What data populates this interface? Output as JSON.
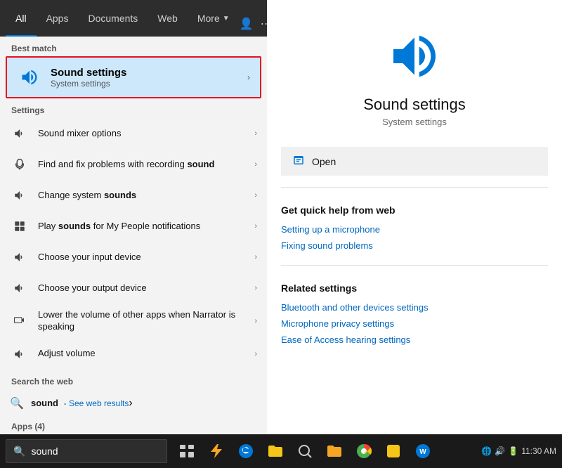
{
  "tabs": {
    "all": "All",
    "apps": "Apps",
    "documents": "Documents",
    "web": "Web",
    "more": "More",
    "more_arrow": "▼"
  },
  "best_match": {
    "label": "Best match",
    "title": "Sound settings",
    "subtitle": "System settings"
  },
  "settings_section": "Settings",
  "settings_items": [
    {
      "label": "Sound mixer options",
      "icon": "sound"
    },
    {
      "label_parts": [
        "Find and fix problems with recording ",
        "sound"
      ],
      "icon": "record"
    },
    {
      "label_parts": [
        "Change system ",
        "sounds"
      ],
      "icon": "sound"
    },
    {
      "label_parts": [
        "Play ",
        "sounds",
        " for My People notifications"
      ],
      "icon": "notification"
    },
    {
      "label_parts": [
        "Choose your input device"
      ],
      "icon": "sound"
    },
    {
      "label_parts": [
        "Choose your output device"
      ],
      "icon": "sound"
    },
    {
      "label_parts": [
        "Lower the volume of other apps when Narrator is speaking"
      ],
      "icon": "narrator"
    },
    {
      "label_parts": [
        "Adjust volume"
      ],
      "icon": "sound"
    }
  ],
  "web_search": {
    "section": "Search the web",
    "query": "sound",
    "see_web": "- See web results"
  },
  "apps_section": "Apps (4)",
  "detail": {
    "title": "Sound settings",
    "subtitle": "System settings",
    "open_label": "Open",
    "quick_help_title": "Get quick help from web",
    "quick_help_links": [
      "Setting up a microphone",
      "Fixing sound problems"
    ],
    "related_title": "Related settings",
    "related_links": [
      "Bluetooth and other devices settings",
      "Microphone privacy settings",
      "Ease of Access hearing settings"
    ]
  },
  "taskbar": {
    "search_placeholder": "sound",
    "search_value": "sound"
  }
}
